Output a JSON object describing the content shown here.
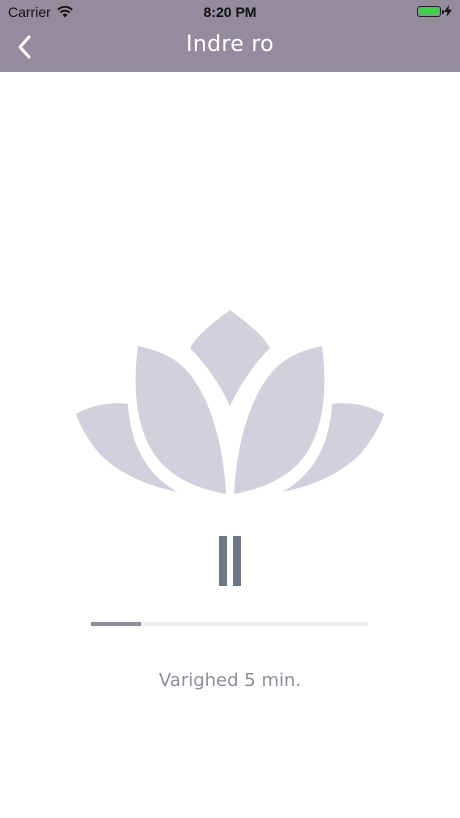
{
  "status_bar": {
    "carrier": "Carrier",
    "time": "8:20 PM",
    "battery_level": 1.0,
    "icons": [
      "wifi-icon",
      "battery-icon",
      "charging-bolt-icon"
    ]
  },
  "nav": {
    "title": "Indre ro",
    "back_icon": "chevron-left-icon"
  },
  "player": {
    "artwork_icon": "lotus-icon",
    "control_icon": "pause-icon",
    "progress_fraction": 0.18,
    "duration_label": "Varighed 5 min."
  },
  "colors": {
    "header": "#938c9d",
    "lotus": "#d4cfdc",
    "pause": "#6d7785",
    "progress_track": "#f0eff2",
    "progress_fill": "#8a8f98",
    "text_muted": "#8a8e98"
  }
}
